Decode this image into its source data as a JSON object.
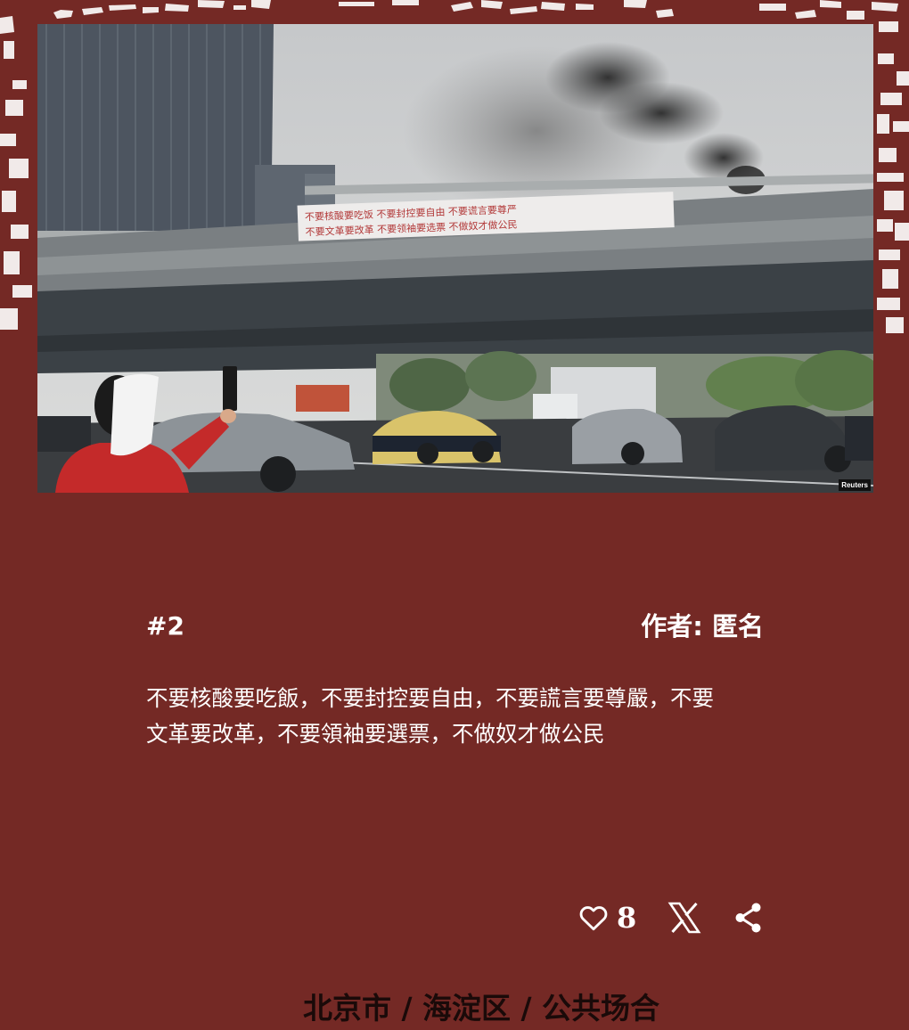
{
  "post": {
    "number": "#2",
    "author": "作者: 匿名",
    "message": "不要核酸要吃飯，不要封控要自由，不要謊言要尊嚴，不要文革要改革，不要領袖要選票，不做奴才做公民",
    "likes": "8",
    "location": "北京市 / 海淀区 / 公共场合"
  },
  "photo": {
    "credit": "Reuters",
    "banner_line1": "不要核酸要吃饭 不要封控要自由 不要谎言要尊严",
    "banner_line2": "不要文革要改革 不要领袖要选票 不做奴才做公民"
  },
  "icons": {
    "like": "heart-outline-icon",
    "x": "x-logo-icon",
    "share": "share-icon"
  },
  "colors": {
    "background": "#742925",
    "text": "#ffffff",
    "location_text": "#1a0a09"
  }
}
